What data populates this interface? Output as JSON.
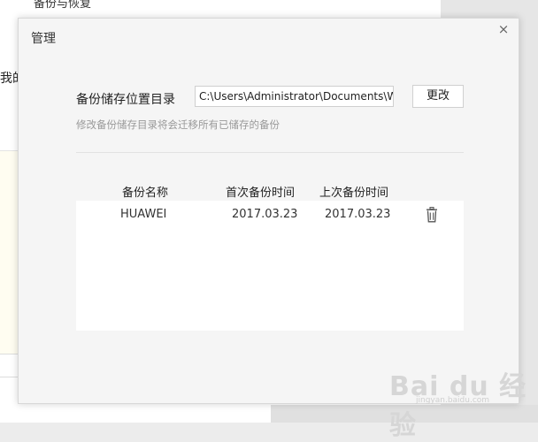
{
  "background": {
    "window_title": "备份与恢复",
    "partial_text": "我的"
  },
  "dialog": {
    "title": "管理",
    "close_glyph": "×",
    "location_label": "备份储存位置目录",
    "path_value": "C:\\Users\\Administrator\\Documents\\WeChat Files",
    "change_button": "更改",
    "hint": "修改备份储存目录将会迁移所有已储存的备份"
  },
  "table": {
    "headers": [
      "备份名称",
      "首次备份时间",
      "上次备份时间"
    ],
    "rows": [
      {
        "name": "HUAWEI",
        "first": "2017.03.23",
        "last": "2017.03.23"
      }
    ]
  },
  "icons": {
    "delete": "trash-icon",
    "close": "close-icon"
  },
  "watermark": {
    "main": "Bai du 经验",
    "sub": "jingyan.baidu.com"
  },
  "colors": {
    "dialog_bg": "#f5f5f5",
    "table_bg": "#ffffff",
    "hint": "#999999"
  }
}
